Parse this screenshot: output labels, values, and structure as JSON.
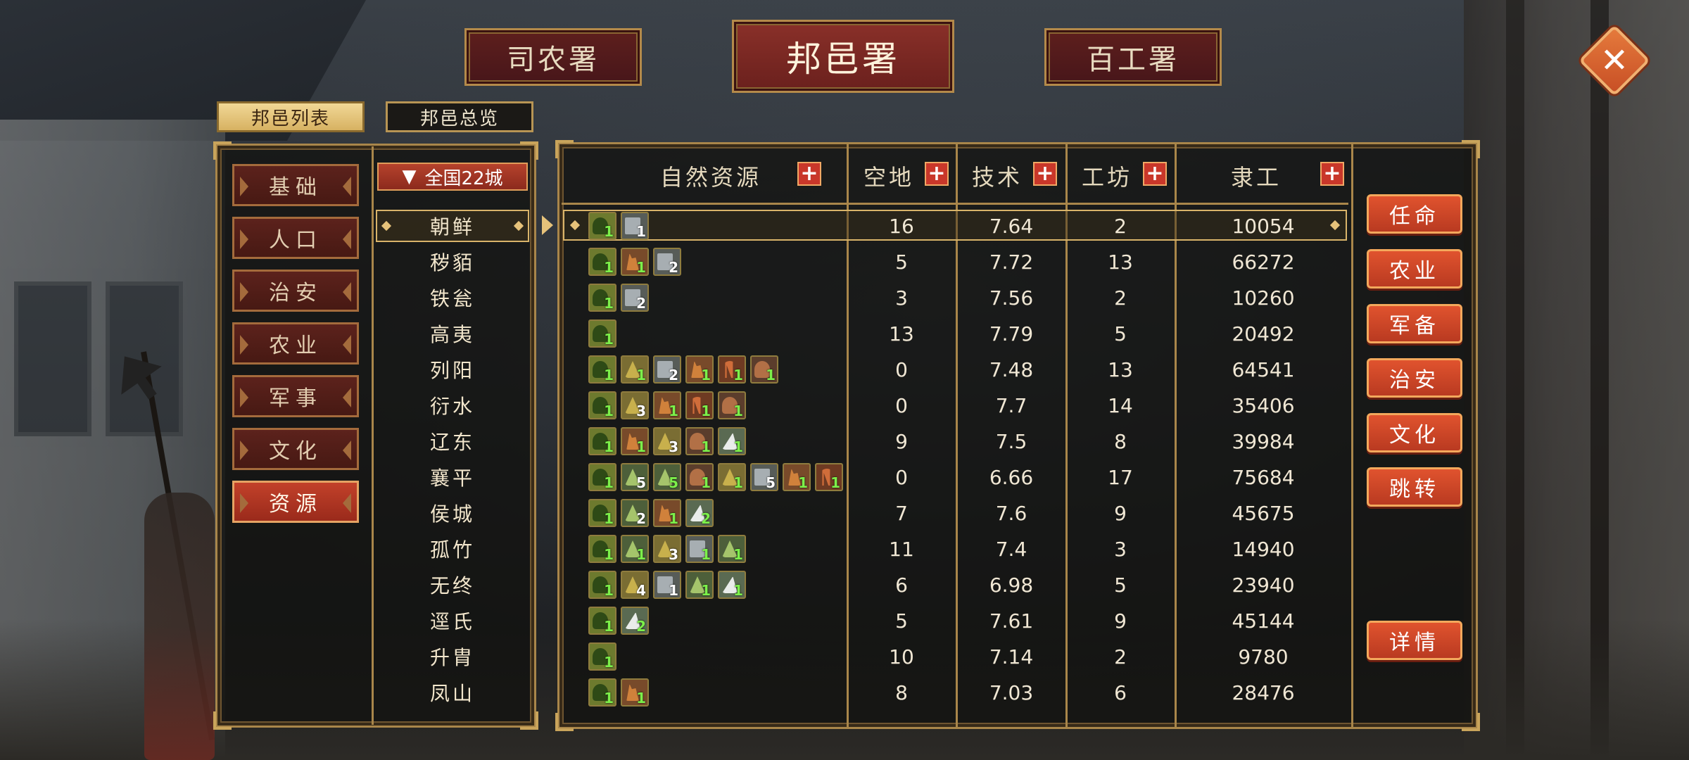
{
  "top_tabs": [
    {
      "label": "司农署",
      "active": false
    },
    {
      "label": "邦邑署",
      "active": true
    },
    {
      "label": "百工署",
      "active": false
    }
  ],
  "close_icon": "close-icon",
  "sub_tabs": [
    {
      "label": "邦邑列表",
      "active": true
    },
    {
      "label": "邦邑总览",
      "active": false
    }
  ],
  "categories": [
    {
      "label": "基础",
      "active": false
    },
    {
      "label": "人口",
      "active": false
    },
    {
      "label": "治安",
      "active": false
    },
    {
      "label": "农业",
      "active": false
    },
    {
      "label": "军事",
      "active": false
    },
    {
      "label": "文化",
      "active": false
    },
    {
      "label": "资源",
      "active": true
    }
  ],
  "filter": {
    "arrow": "▼",
    "label": "全国22城"
  },
  "table": {
    "headers": {
      "resources": "自然资源",
      "land": "空地",
      "tech": "技术",
      "workshop": "工坊",
      "labor": "隶工"
    },
    "plus_label": "+",
    "rows": [
      {
        "city": "朝鲜",
        "selected": true,
        "land": "16",
        "tech": "7.64",
        "workshop": "2",
        "labor": "10054",
        "resources": [
          {
            "type": "tree",
            "count": "1",
            "color": "green"
          },
          {
            "type": "stone",
            "count": "1",
            "color": "white"
          }
        ]
      },
      {
        "city": "秽貊",
        "land": "5",
        "tech": "7.72",
        "workshop": "13",
        "labor": "66272",
        "resources": [
          {
            "type": "tree",
            "count": "1",
            "color": "green"
          },
          {
            "type": "deer",
            "count": "1",
            "color": "green"
          },
          {
            "type": "stone",
            "count": "2",
            "color": "white"
          }
        ]
      },
      {
        "city": "铁瓮",
        "land": "3",
        "tech": "7.56",
        "workshop": "2",
        "labor": "10260",
        "resources": [
          {
            "type": "tree",
            "count": "1",
            "color": "green"
          },
          {
            "type": "stone",
            "count": "2",
            "color": "white"
          }
        ]
      },
      {
        "city": "高夷",
        "land": "13",
        "tech": "7.79",
        "workshop": "5",
        "labor": "20492",
        "resources": [
          {
            "type": "tree",
            "count": "1",
            "color": "green"
          }
        ]
      },
      {
        "city": "列阳",
        "land": "0",
        "tech": "7.48",
        "workshop": "13",
        "labor": "64541",
        "resources": [
          {
            "type": "tree",
            "count": "1",
            "color": "green"
          },
          {
            "type": "grain",
            "count": "1",
            "color": "green"
          },
          {
            "type": "stone",
            "count": "2",
            "color": "white"
          },
          {
            "type": "deer",
            "count": "1",
            "color": "green"
          },
          {
            "type": "forest",
            "count": "1",
            "color": "green"
          },
          {
            "type": "horse",
            "count": "1",
            "color": "green"
          }
        ]
      },
      {
        "city": "衍水",
        "land": "0",
        "tech": "7.7",
        "workshop": "14",
        "labor": "35406",
        "resources": [
          {
            "type": "tree",
            "count": "1",
            "color": "green"
          },
          {
            "type": "grain",
            "count": "3",
            "color": "white"
          },
          {
            "type": "deer",
            "count": "1",
            "color": "green"
          },
          {
            "type": "forest",
            "count": "1",
            "color": "green"
          },
          {
            "type": "horse",
            "count": "1",
            "color": "green"
          }
        ]
      },
      {
        "city": "辽东",
        "land": "9",
        "tech": "7.5",
        "workshop": "8",
        "labor": "39984",
        "resources": [
          {
            "type": "tree",
            "count": "1",
            "color": "green"
          },
          {
            "type": "deer",
            "count": "1",
            "color": "green"
          },
          {
            "type": "grain",
            "count": "3",
            "color": "white"
          },
          {
            "type": "horse",
            "count": "1",
            "color": "green"
          },
          {
            "type": "salt",
            "count": "1",
            "color": "green"
          }
        ]
      },
      {
        "city": "襄平",
        "land": "0",
        "tech": "6.66",
        "workshop": "17",
        "labor": "75684",
        "resources": [
          {
            "type": "tree",
            "count": "1",
            "color": "green"
          },
          {
            "type": "herb",
            "count": "5",
            "color": "white"
          },
          {
            "type": "herb",
            "count": "5",
            "color": "green"
          },
          {
            "type": "horse",
            "count": "1",
            "color": "green"
          },
          {
            "type": "grain",
            "count": "1",
            "color": "green"
          },
          {
            "type": "stone",
            "count": "5",
            "color": "white"
          },
          {
            "type": "deer",
            "count": "1",
            "color": "green"
          },
          {
            "type": "forest",
            "count": "1",
            "color": "green"
          }
        ]
      },
      {
        "city": "侯城",
        "land": "7",
        "tech": "7.6",
        "workshop": "9",
        "labor": "45675",
        "resources": [
          {
            "type": "tree",
            "count": "1",
            "color": "green"
          },
          {
            "type": "herb",
            "count": "2",
            "color": "white"
          },
          {
            "type": "deer",
            "count": "1",
            "color": "green"
          },
          {
            "type": "salt",
            "count": "2",
            "color": "green"
          }
        ]
      },
      {
        "city": "孤竹",
        "land": "11",
        "tech": "7.4",
        "workshop": "3",
        "labor": "14940",
        "resources": [
          {
            "type": "tree",
            "count": "1",
            "color": "green"
          },
          {
            "type": "herb",
            "count": "1",
            "color": "green"
          },
          {
            "type": "grain",
            "count": "3",
            "color": "white"
          },
          {
            "type": "stone",
            "count": "1",
            "color": "green"
          },
          {
            "type": "herb",
            "count": "1",
            "color": "green"
          }
        ]
      },
      {
        "city": "无终",
        "land": "6",
        "tech": "6.98",
        "workshop": "5",
        "labor": "23940",
        "resources": [
          {
            "type": "tree",
            "count": "1",
            "color": "green"
          },
          {
            "type": "grain",
            "count": "4",
            "color": "white"
          },
          {
            "type": "stone",
            "count": "1",
            "color": "white"
          },
          {
            "type": "herb",
            "count": "1",
            "color": "green"
          },
          {
            "type": "salt",
            "count": "1",
            "color": "green"
          }
        ]
      },
      {
        "city": "逕氏",
        "land": "5",
        "tech": "7.61",
        "workshop": "9",
        "labor": "45144",
        "resources": [
          {
            "type": "tree",
            "count": "1",
            "color": "green"
          },
          {
            "type": "salt",
            "count": "2",
            "color": "green"
          }
        ]
      },
      {
        "city": "升胄",
        "land": "10",
        "tech": "7.14",
        "workshop": "2",
        "labor": "9780",
        "resources": [
          {
            "type": "tree",
            "count": "1",
            "color": "green"
          }
        ]
      },
      {
        "city": "凤山",
        "land": "8",
        "tech": "7.03",
        "workshop": "6",
        "labor": "28476",
        "resources": [
          {
            "type": "tree",
            "count": "1",
            "color": "green"
          },
          {
            "type": "deer",
            "count": "1",
            "color": "green"
          }
        ]
      }
    ]
  },
  "actions": [
    {
      "label": "任命"
    },
    {
      "label": "农业"
    },
    {
      "label": "军备"
    },
    {
      "label": "治安"
    },
    {
      "label": "文化"
    },
    {
      "label": "跳转"
    }
  ],
  "detail_button": {
    "label": "详情"
  }
}
